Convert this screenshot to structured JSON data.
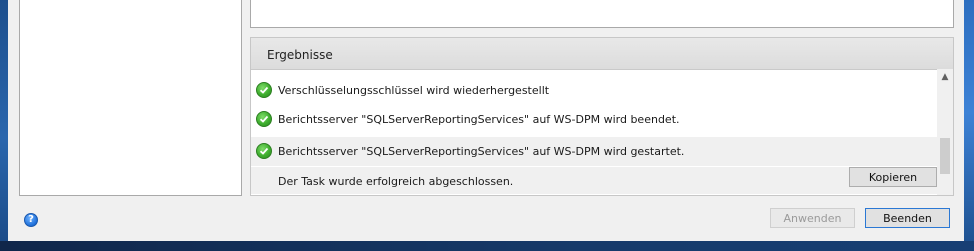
{
  "results": {
    "header": "Ergebnisse",
    "rows": [
      {
        "label": "Verschlüsselungsschlüssel wird wiederhergestellt",
        "icon": "success-check-icon"
      },
      {
        "label": "Berichtsserver \"SQLServerReportingServices\" auf WS-DPM wird beendet.",
        "icon": "success-check-icon"
      },
      {
        "label": "Berichtsserver \"SQLServerReportingServices\" auf WS-DPM wird gestartet.",
        "icon": "success-check-icon"
      }
    ],
    "status_text": "Der Task wurde erfolgreich abgeschlossen.",
    "copy_label": "Kopieren"
  },
  "footer": {
    "apply_label": "Anwenden",
    "exit_label": "Beenden",
    "help_glyph": "?"
  },
  "colors": {
    "success": "#3fae2f",
    "accent": "#2b78d4",
    "desktop": "#1c3f70"
  }
}
